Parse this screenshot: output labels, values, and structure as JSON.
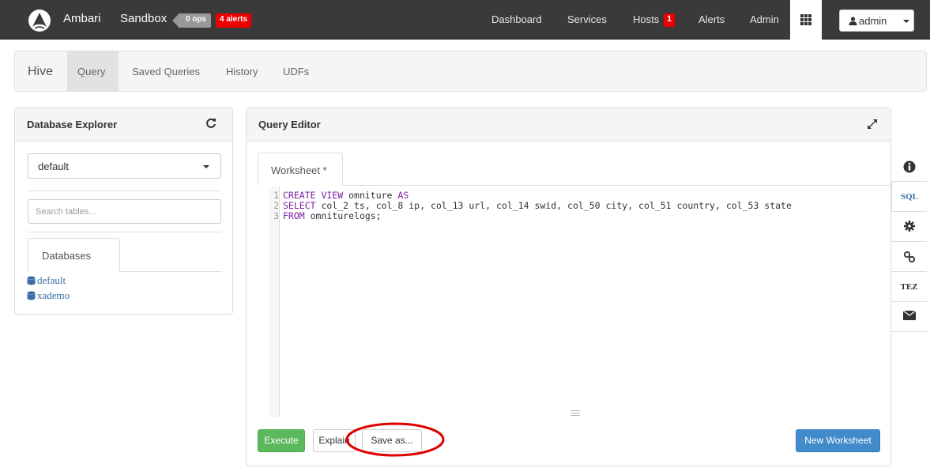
{
  "nav": {
    "brand": "Ambari",
    "cluster": "Sandbox",
    "ops_badge": "0 ops",
    "alerts_badge": "4 alerts",
    "links": {
      "dashboard": "Dashboard",
      "services": "Services",
      "hosts": "Hosts",
      "alerts": "Alerts",
      "admin": "Admin"
    },
    "hosts_badge": "1",
    "user": "admin"
  },
  "hive_bar": {
    "title": "Hive",
    "tabs": [
      "Query",
      "Saved Queries",
      "History",
      "UDFs"
    ],
    "active_tab": "Query"
  },
  "db_explorer": {
    "title": "Database Explorer",
    "selected_db": "default",
    "search_placeholder": "Search tables...",
    "tab": "Databases",
    "databases": [
      "default",
      "xademo"
    ]
  },
  "query_editor": {
    "title": "Query Editor",
    "worksheet_tab": "Worksheet *",
    "code": {
      "line1": {
        "num": "1",
        "kw1": "CREATE VIEW",
        "mid": " omniture ",
        "kw2": "AS"
      },
      "line2": {
        "num": "2",
        "kw": "SELECT",
        "rest": " col_2 ts, col_8 ip, col_13 url, col_14 swid, col_50 city, col_51 country, col_53 state"
      },
      "line3": {
        "num": "3",
        "kw": "FROM",
        "rest": " omniturelogs;"
      }
    },
    "buttons": {
      "execute": "Execute",
      "explain": "Explain",
      "save_as": "Save as...",
      "new_worksheet": "New Worksheet"
    }
  },
  "right_sidebar": {
    "sql": "SQL",
    "tez": "TEZ"
  },
  "colors": {
    "nav_bg": "#3a3a3a",
    "alert_red": "#ee0000",
    "execute_green": "#5cb85c",
    "primary_blue": "#428bca",
    "annotation_red": "#e00000"
  }
}
